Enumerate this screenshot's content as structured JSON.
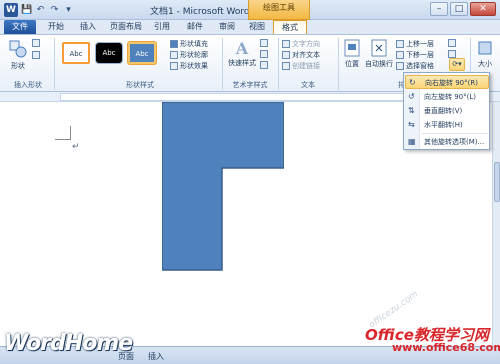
{
  "window": {
    "title": "文档1 - Microsoft Word",
    "context_tab_header": "绘图工具",
    "buttons": {
      "minimize": "–",
      "maximize": "□",
      "close": "✕"
    }
  },
  "qat": {
    "app_icon": "W",
    "save": "💾",
    "undo": "↶",
    "redo": "↷",
    "customize": "▾"
  },
  "tabs": [
    {
      "label": "文件"
    },
    {
      "label": "开始"
    },
    {
      "label": "插入"
    },
    {
      "label": "页面布局"
    },
    {
      "label": "引用"
    },
    {
      "label": "邮件"
    },
    {
      "label": "审阅"
    },
    {
      "label": "视图"
    },
    {
      "label": "格式"
    }
  ],
  "ribbon": {
    "insert_shapes": {
      "shape_label": "形状",
      "group_label": "插入形状"
    },
    "shape_styles": {
      "style1": "Abc",
      "style2": "Abc",
      "style3": "Abc",
      "fill": "形状填充",
      "outline": "形状轮廓",
      "effects": "形状效果",
      "group_label": "形状样式"
    },
    "wordart": {
      "quick_styles": "快速样式",
      "group_label": "艺术字样式"
    },
    "text": {
      "direction": "文字方向",
      "align": "对齐文本",
      "link": "创建链接",
      "group_label": "文本"
    },
    "arrange": {
      "position": "位置",
      "wrap": "自动换行",
      "bring_forward": "上移一层",
      "send_backward": "下移一层",
      "selection_pane": "选择窗格",
      "group_label": "排列"
    },
    "size": {
      "label": "大小"
    }
  },
  "rotate_menu": {
    "items": [
      {
        "label": "向右旋转 90°(R)",
        "icon": "rotate-right-icon",
        "glyph": "↻"
      },
      {
        "label": "向左旋转 90°(L)",
        "icon": "rotate-left-icon",
        "glyph": "↺"
      },
      {
        "label": "垂直翻转(V)",
        "icon": "flip-vertical-icon",
        "glyph": "⇅"
      },
      {
        "label": "水平翻转(H)",
        "icon": "flip-horizontal-icon",
        "glyph": "⇆"
      },
      {
        "label": "其他旋转选项(M)...",
        "icon": "more-rotation-icon",
        "glyph": "▦"
      }
    ]
  },
  "document": {
    "paragraph_mark": "↵",
    "shape_color": "#4f81bd",
    "shape_outline": "#385d8a"
  },
  "statusbar": {
    "mode": "插入",
    "page_info": "页面"
  },
  "watermarks": {
    "brand": "WordHome",
    "cn_title": "Office教程学习网",
    "site": "www.office68.com",
    "diagonal": "officezu.com"
  }
}
